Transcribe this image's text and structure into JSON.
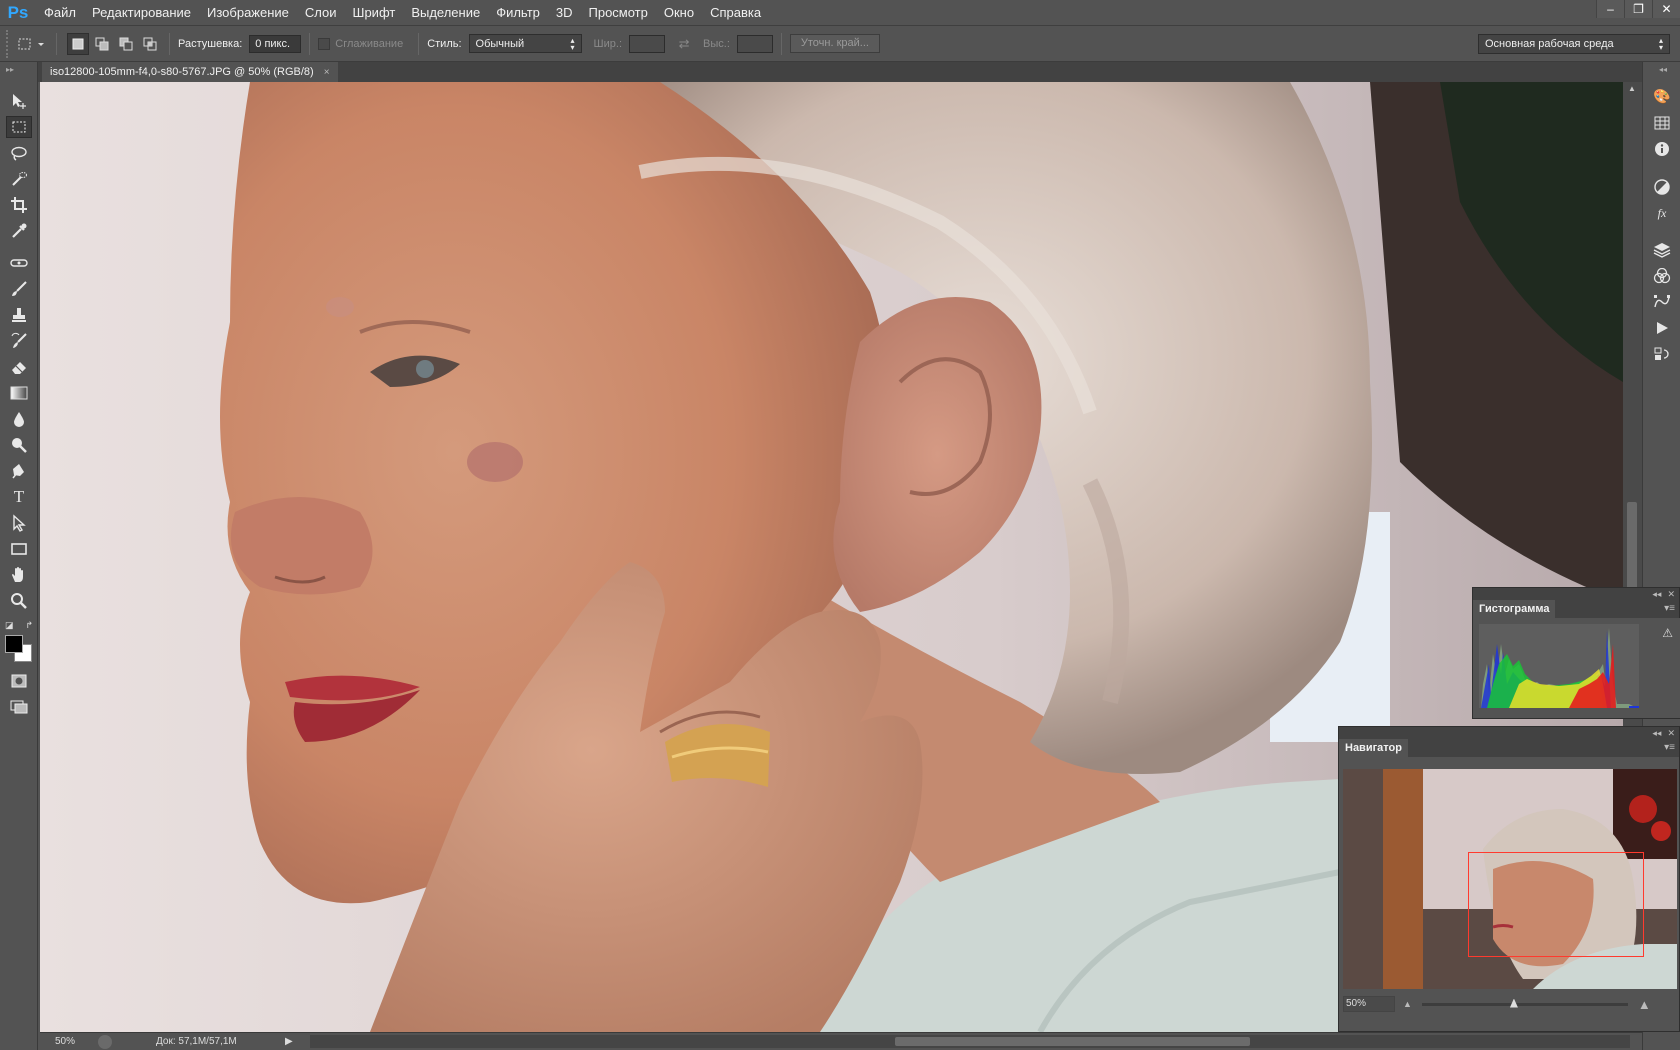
{
  "app": {
    "logo": "Ps"
  },
  "menu": [
    "Файл",
    "Редактирование",
    "Изображение",
    "Слои",
    "Шрифт",
    "Выделение",
    "Фильтр",
    "3D",
    "Просмотр",
    "Окно",
    "Справка"
  ],
  "window_controls": {
    "minimize": "–",
    "restore": "❐",
    "close": "✕"
  },
  "options": {
    "feather_label": "Растушевка:",
    "feather_value": "0 пикс.",
    "antialias_label": "Сглаживание",
    "style_label": "Стиль:",
    "style_value": "Обычный",
    "width_label": "Шир.:",
    "height_label": "Выс.:",
    "refine_edge": "Уточн. край...",
    "workspace": "Основная рабочая среда"
  },
  "document": {
    "tab_title": "iso12800-105mm-f4,0-s80-5767.JPG @ 50% (RGB/8)",
    "close_glyph": "×"
  },
  "status": {
    "zoom": "50%",
    "doc_size": "Док: 57,1M/57,1M"
  },
  "histogram": {
    "tab": "Гистограмма",
    "warning": "⚠"
  },
  "navigator": {
    "tab": "Навигатор",
    "zoom": "50%"
  },
  "colors": {
    "ui_bg": "#535353",
    "ui_dark": "#424242",
    "navigator_view_box": "#ff3a2e",
    "ps_logo": "#31a8ff"
  },
  "icons": {
    "tools": [
      "move-icon",
      "rect-marquee-icon",
      "lasso-icon",
      "quick-select-icon",
      "crop-icon",
      "eyedropper-icon",
      "healing-icon",
      "brush-icon",
      "clone-stamp-icon",
      "history-brush-icon",
      "eraser-icon",
      "gradient-icon",
      "blur-icon",
      "dodge-icon",
      "pen-icon",
      "type-icon",
      "path-select-icon",
      "rectangle-shape-icon",
      "hand-icon",
      "zoom-icon"
    ],
    "right_strip": [
      "color-icon",
      "swatches-icon",
      "info-icon",
      "adjustments-icon",
      "styles-icon",
      "layers-icon",
      "channels-icon",
      "paths-icon",
      "actions-icon",
      "history-icon"
    ]
  }
}
